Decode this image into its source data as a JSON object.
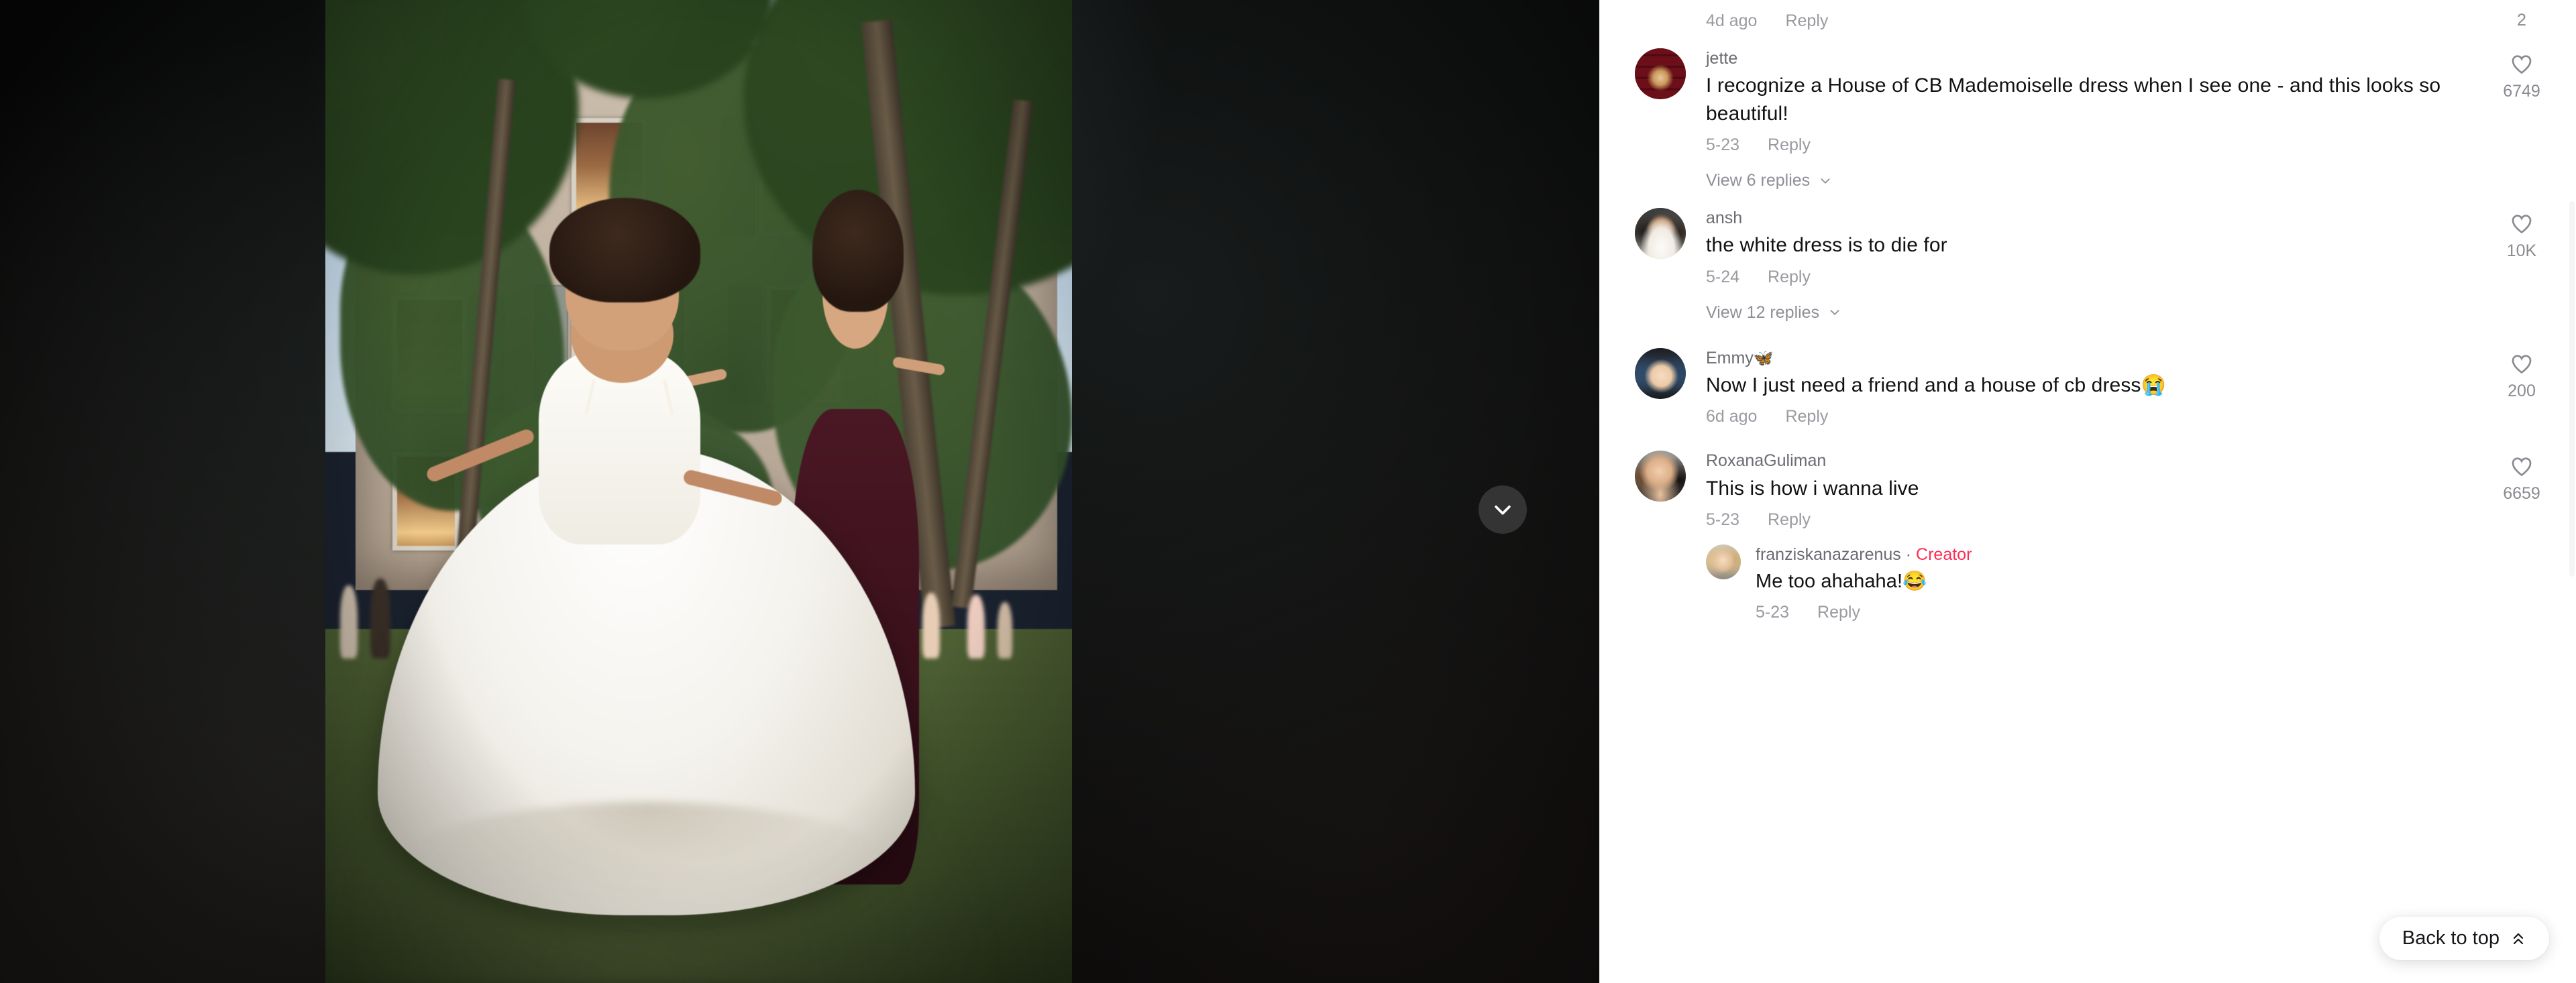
{
  "video": {
    "next_button_label": "next-video",
    "scene_alt": "Woman in a white strapless gown twirling on a lawn in front of an ivy-covered château at dusk, a second woman in a maroon dress dancing beside her"
  },
  "comments_panel": {
    "top_partial_comment": {
      "time": "4d ago",
      "reply_label": "Reply",
      "likes": "2"
    },
    "comments": [
      {
        "username": "jette",
        "avatar": "av-jette",
        "text": "I recognize a House of CB Mademoiselle dress when I see one - and this looks so beautiful!",
        "time": "5-23",
        "reply_label": "Reply",
        "likes": "6749",
        "view_replies": "View 6 replies"
      },
      {
        "username": "ansh",
        "avatar": "av-ansh",
        "text": "the white dress is to die for",
        "time": "5-24",
        "reply_label": "Reply",
        "likes": "10K",
        "view_replies": "View 12 replies"
      },
      {
        "username": "Emmy",
        "username_emoji": "🦋",
        "avatar": "av-emmy",
        "text": "Now I just need a friend and a house of cb dress😭",
        "time": "6d ago",
        "reply_label": "Reply",
        "likes": "200",
        "view_replies": ""
      },
      {
        "username": "RoxanaGuliman",
        "avatar": "av-roxana",
        "text": "This is how i wanna live",
        "time": "5-23",
        "reply_label": "Reply",
        "likes": "6659",
        "view_replies": "",
        "reply": {
          "username": "franziskanazarenus",
          "separator": "·",
          "badge": "Creator",
          "badge_color": "#fe2c55",
          "avatar": "av-creator",
          "text": "Me too ahahaha!😂",
          "time": "5-23",
          "reply_label": "Reply"
        }
      }
    ],
    "back_to_top_label": "Back to top"
  }
}
